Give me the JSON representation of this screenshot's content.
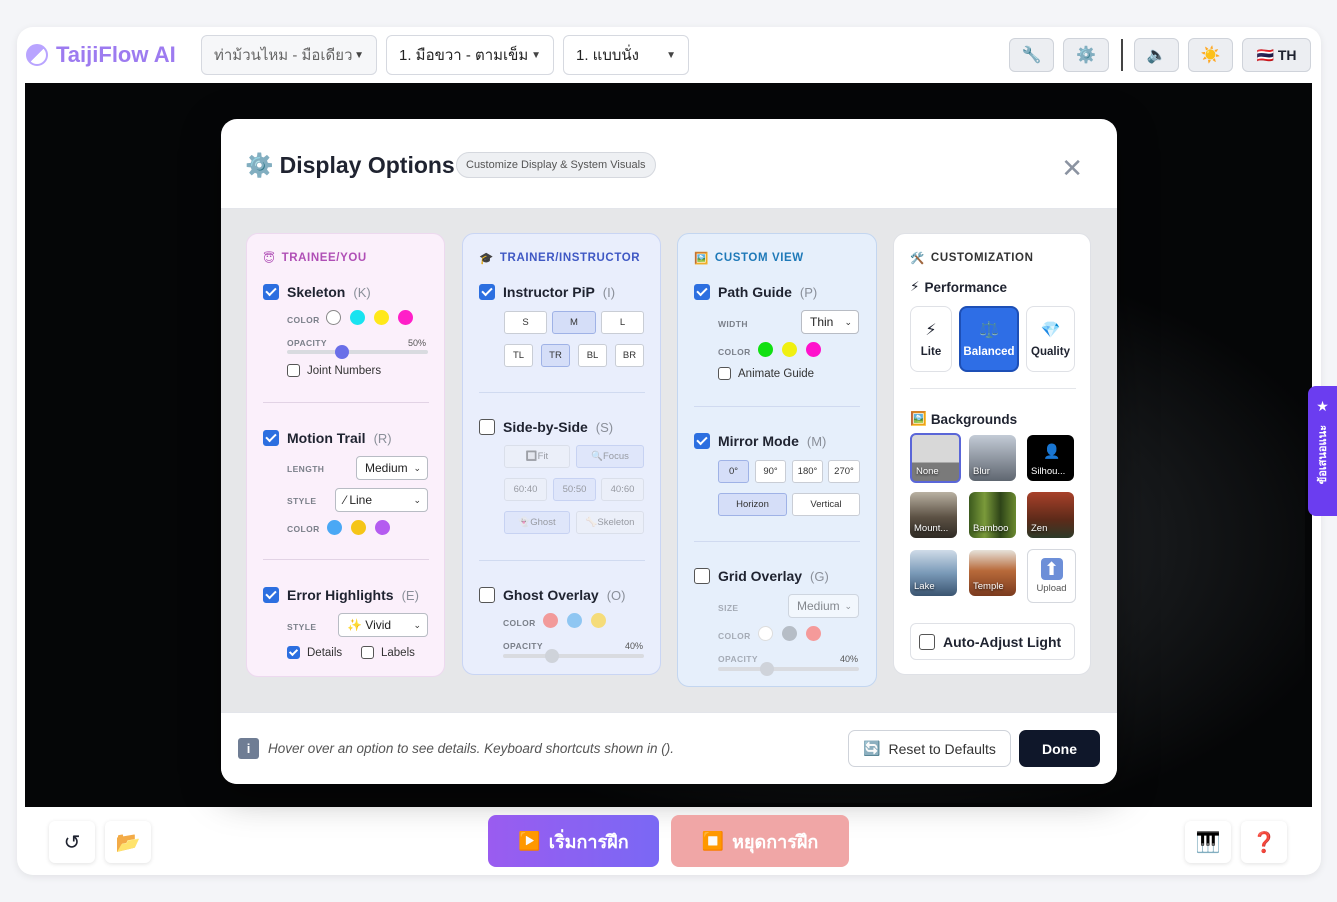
{
  "app": {
    "title": "TaijiFlow AI"
  },
  "toolbar": {
    "form_select": "ท่าม้วนไหม - มือเดียว",
    "hand_select": "1. มือขวา - ตามเข็ม",
    "pose_select": "1. แบบนั่ง",
    "lang": "🇹🇭 TH",
    "icons": [
      "wrench-icon",
      "gear-icon",
      "sound-off-icon",
      "sun-icon"
    ]
  },
  "side_tab": {
    "label": "ข้อเสนอแนะ"
  },
  "modal": {
    "title": "Display Options",
    "tag": "Customize Display & System Visuals",
    "trainee": {
      "header": "TRAINEE/YOU",
      "skeleton": {
        "label": "Skeleton",
        "key": "(K)",
        "checked": true,
        "color_label": "COLOR",
        "colors": [
          "#ffffff",
          "#19e3f0",
          "#ffe81a",
          "#ff1fc8"
        ],
        "opacity_label": "OPACITY",
        "opacity": "50%",
        "joint_numbers": "Joint Numbers"
      },
      "motion_trail": {
        "label": "Motion Trail",
        "key": "(R)",
        "checked": true,
        "length_label": "LENGTH",
        "length": "Medium",
        "style_label": "STYLE",
        "style": "Line",
        "color_label": "COLOR",
        "colors": [
          "#4aa8f5",
          "#f5c518",
          "#b45cf0"
        ]
      },
      "error_highlights": {
        "label": "Error Highlights",
        "key": "(E)",
        "checked": true,
        "style_label": "STYLE",
        "style": "✨ Vivid",
        "details": "Details",
        "labels": "Labels"
      }
    },
    "trainer": {
      "header": "TRAINER/INSTRUCTOR",
      "pip": {
        "label": "Instructor PiP",
        "key": "(I)",
        "checked": true,
        "sizes": [
          "S",
          "M",
          "L"
        ],
        "positions": [
          "TL",
          "TR",
          "BL",
          "BR"
        ]
      },
      "sbs": {
        "label": "Side-by-Side",
        "key": "(S)",
        "modes": [
          "Fit",
          "Focus"
        ],
        "ratios": [
          "60:40",
          "50:50",
          "40:60"
        ],
        "views": [
          "Ghost",
          "Skeleton"
        ]
      },
      "ghost": {
        "label": "Ghost Overlay",
        "key": "(O)",
        "color_label": "COLOR",
        "colors": [
          "#f29a9a",
          "#8fc6f2",
          "#f5dc7a"
        ],
        "opacity_label": "OPACITY",
        "opacity": "40%"
      }
    },
    "custom": {
      "header": "CUSTOM VIEW",
      "path": {
        "label": "Path Guide",
        "key": "(P)",
        "checked": true,
        "width_label": "WIDTH",
        "width": "Thin",
        "color_label": "COLOR",
        "colors": [
          "#11e011",
          "#f0f011",
          "#ff11cc"
        ],
        "animate": "Animate Guide"
      },
      "mirror": {
        "label": "Mirror Mode",
        "key": "(M)",
        "checked": true,
        "angles": [
          "0°",
          "90°",
          "180°",
          "270°"
        ],
        "axes": [
          "Horizon",
          "Vertical"
        ]
      },
      "grid": {
        "label": "Grid Overlay",
        "key": "(G)",
        "size_label": "SIZE",
        "size": "Medium",
        "color_label": "COLOR",
        "colors": [
          "#ffffff",
          "#9aa3ad",
          "#ff7b7b"
        ],
        "opacity_label": "OPACITY",
        "opacity": "40%"
      }
    },
    "customization": {
      "header": "CUSTOMIZATION",
      "performance": "Performance",
      "perf_options": [
        "Lite",
        "Balanced",
        "Quality"
      ],
      "backgrounds": "Backgrounds",
      "bg_items": [
        "None",
        "Blur",
        "Silhou...",
        "Mount...",
        "Bamboo",
        "Zen",
        "Lake",
        "Temple",
        "Upload"
      ],
      "auto_adjust": "Auto-Adjust Light"
    },
    "footer": {
      "hint": "Hover over an option to see details. Keyboard shortcuts shown in ().",
      "reset": "Reset to Defaults",
      "done": "Done"
    }
  },
  "bottom": {
    "start": "เริ่มการฝึก",
    "stop": "หยุดการฝึก"
  }
}
